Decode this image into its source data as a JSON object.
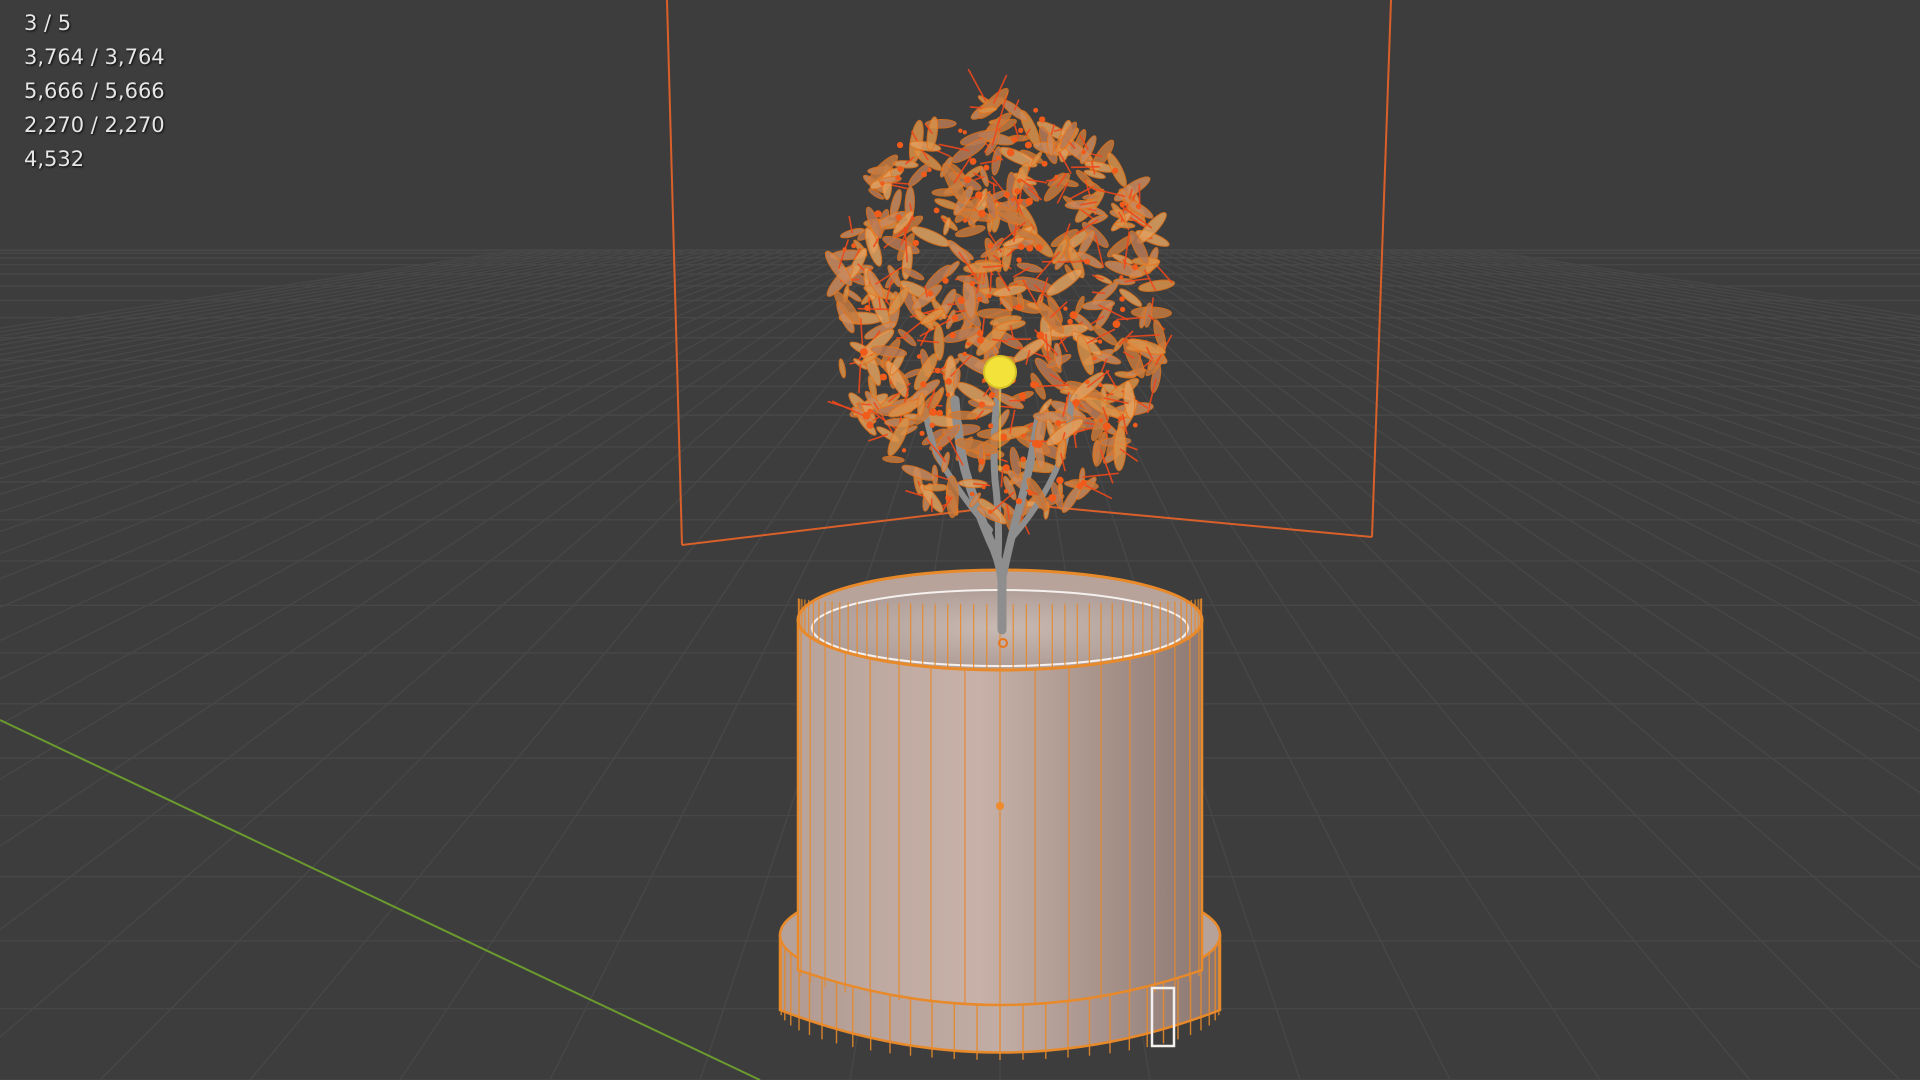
{
  "stats": {
    "objects": "3 / 5",
    "vertices": "3,764 / 3,764",
    "edges": "5,666 / 5,666",
    "faces": "2,270 / 2,270",
    "triangles": "4,532"
  },
  "colors": {
    "background": "#3d3d3d",
    "grid_line": "#4a4a4a",
    "y_axis": "#6b9a2f",
    "selection_orange": "#e8751a",
    "active_outline": "#f0a030",
    "pot_fill": "#a8958e",
    "light_yellow": "#f2e23a"
  },
  "scene": {
    "objects": [
      "camera-frame",
      "tree-plant",
      "pot",
      "light"
    ]
  }
}
